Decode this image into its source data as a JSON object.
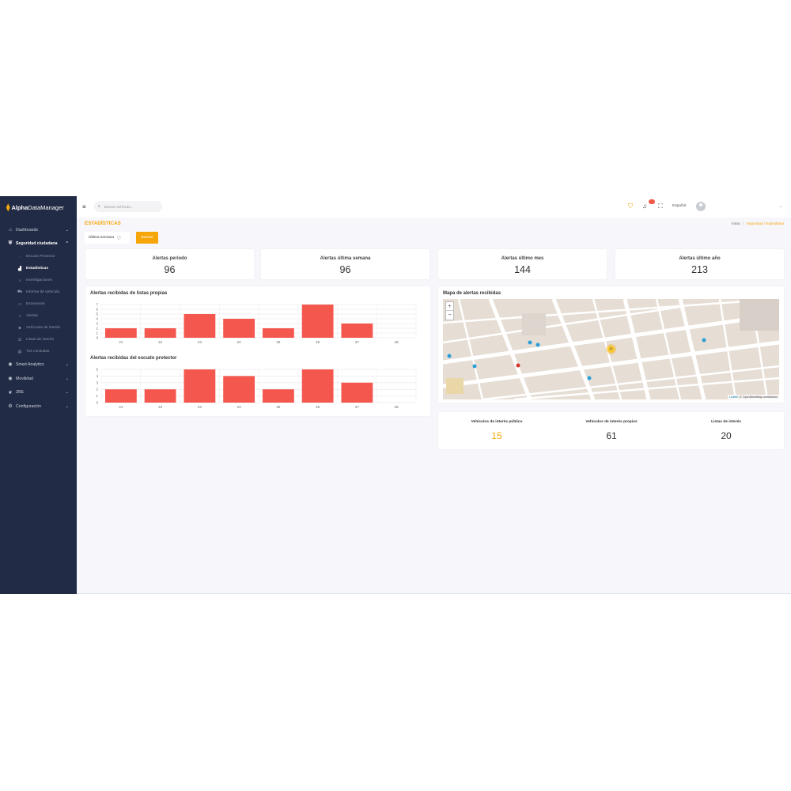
{
  "app": {
    "logo_bold": "Alpha",
    "logo_rest": "DataManager"
  },
  "sidebar": {
    "items": [
      {
        "label": "Dashboards",
        "icon": "home-icon"
      },
      {
        "label": "Seguridad ciudadana",
        "icon": "shield-icon",
        "expanded": true
      },
      {
        "label": "Smart Analytics",
        "icon": "pin-icon"
      },
      {
        "label": "Movilidad",
        "icon": "pin-icon"
      },
      {
        "label": "ZBE",
        "icon": "leaf-icon"
      },
      {
        "label": "Configuración",
        "icon": "gear-icon"
      }
    ],
    "subitems": [
      {
        "label": "Escudo Protector",
        "icon": "shield-icon"
      },
      {
        "label": "Estadísticas",
        "icon": "chart-icon",
        "active": true
      },
      {
        "label": "Investigaciones",
        "icon": "search-icon"
      },
      {
        "label": "Informe de vehículo",
        "icon": "car-icon"
      },
      {
        "label": "Escenarios",
        "icon": "screen-icon"
      },
      {
        "label": "Alertas",
        "icon": "bell-icon"
      },
      {
        "label": "Vehículos de interés",
        "icon": "user-icon"
      },
      {
        "label": "Listas de interés",
        "icon": "list-icon"
      },
      {
        "label": "Tus consultas",
        "icon": "doc-icon"
      }
    ]
  },
  "header": {
    "search_placeholder": "Buscar vehículo...",
    "notification_count": "",
    "language": "Español"
  },
  "page": {
    "title": "ESTADÍSTICAS",
    "breadcrumb": [
      "Inicio",
      "Seguridad / Subsidiaria"
    ],
    "filter_value": "Última semana",
    "search_button": "Buscar"
  },
  "stats": [
    {
      "label": "Alertas periodo",
      "value": "96"
    },
    {
      "label": "Alertas última semana",
      "value": "96"
    },
    {
      "label": "Alertas último mes",
      "value": "144"
    },
    {
      "label": "Alertas último año",
      "value": "213"
    }
  ],
  "map": {
    "title": "Mapa de alertas recibidas",
    "zoom_in": "+",
    "zoom_out": "−",
    "cluster_count": "24",
    "attribution_leaflet": "Leaflet",
    "attribution_rest": " | © OpenStreetMap contributors"
  },
  "mini_stats": [
    {
      "label": "Vehículos de interés público",
      "value": "15",
      "color": "#f6a609"
    },
    {
      "label": "Vehículos de interés propios",
      "value": "61",
      "color": "#333333"
    },
    {
      "label": "Listas de interés",
      "value": "20",
      "color": "#333333"
    }
  ],
  "colors": {
    "accent": "#f6a609",
    "sidebar": "#222b45",
    "bar": "#f4574d"
  },
  "chart_data": [
    {
      "type": "bar",
      "title": "Alertas recibidas de listas propias",
      "categories": [
        "21",
        "22",
        "23",
        "24",
        "25",
        "26",
        "27",
        "28"
      ],
      "values": [
        2,
        2,
        5,
        4,
        2,
        7,
        3,
        0
      ],
      "ylim": [
        0,
        7
      ],
      "yticks": [
        "0",
        "1",
        "2",
        "3",
        "4",
        "5",
        "6",
        "7"
      ],
      "grid": true
    },
    {
      "type": "bar",
      "title": "Alertas recibidas del escudo protector",
      "categories": [
        "21",
        "22",
        "23",
        "24",
        "25",
        "26",
        "27",
        "28"
      ],
      "values": [
        2,
        2,
        5,
        4,
        2,
        5,
        3,
        0
      ],
      "ylim": [
        0,
        5
      ],
      "yticks": [
        "0",
        "1",
        "2",
        "3",
        "4",
        "5"
      ],
      "grid": true
    }
  ]
}
